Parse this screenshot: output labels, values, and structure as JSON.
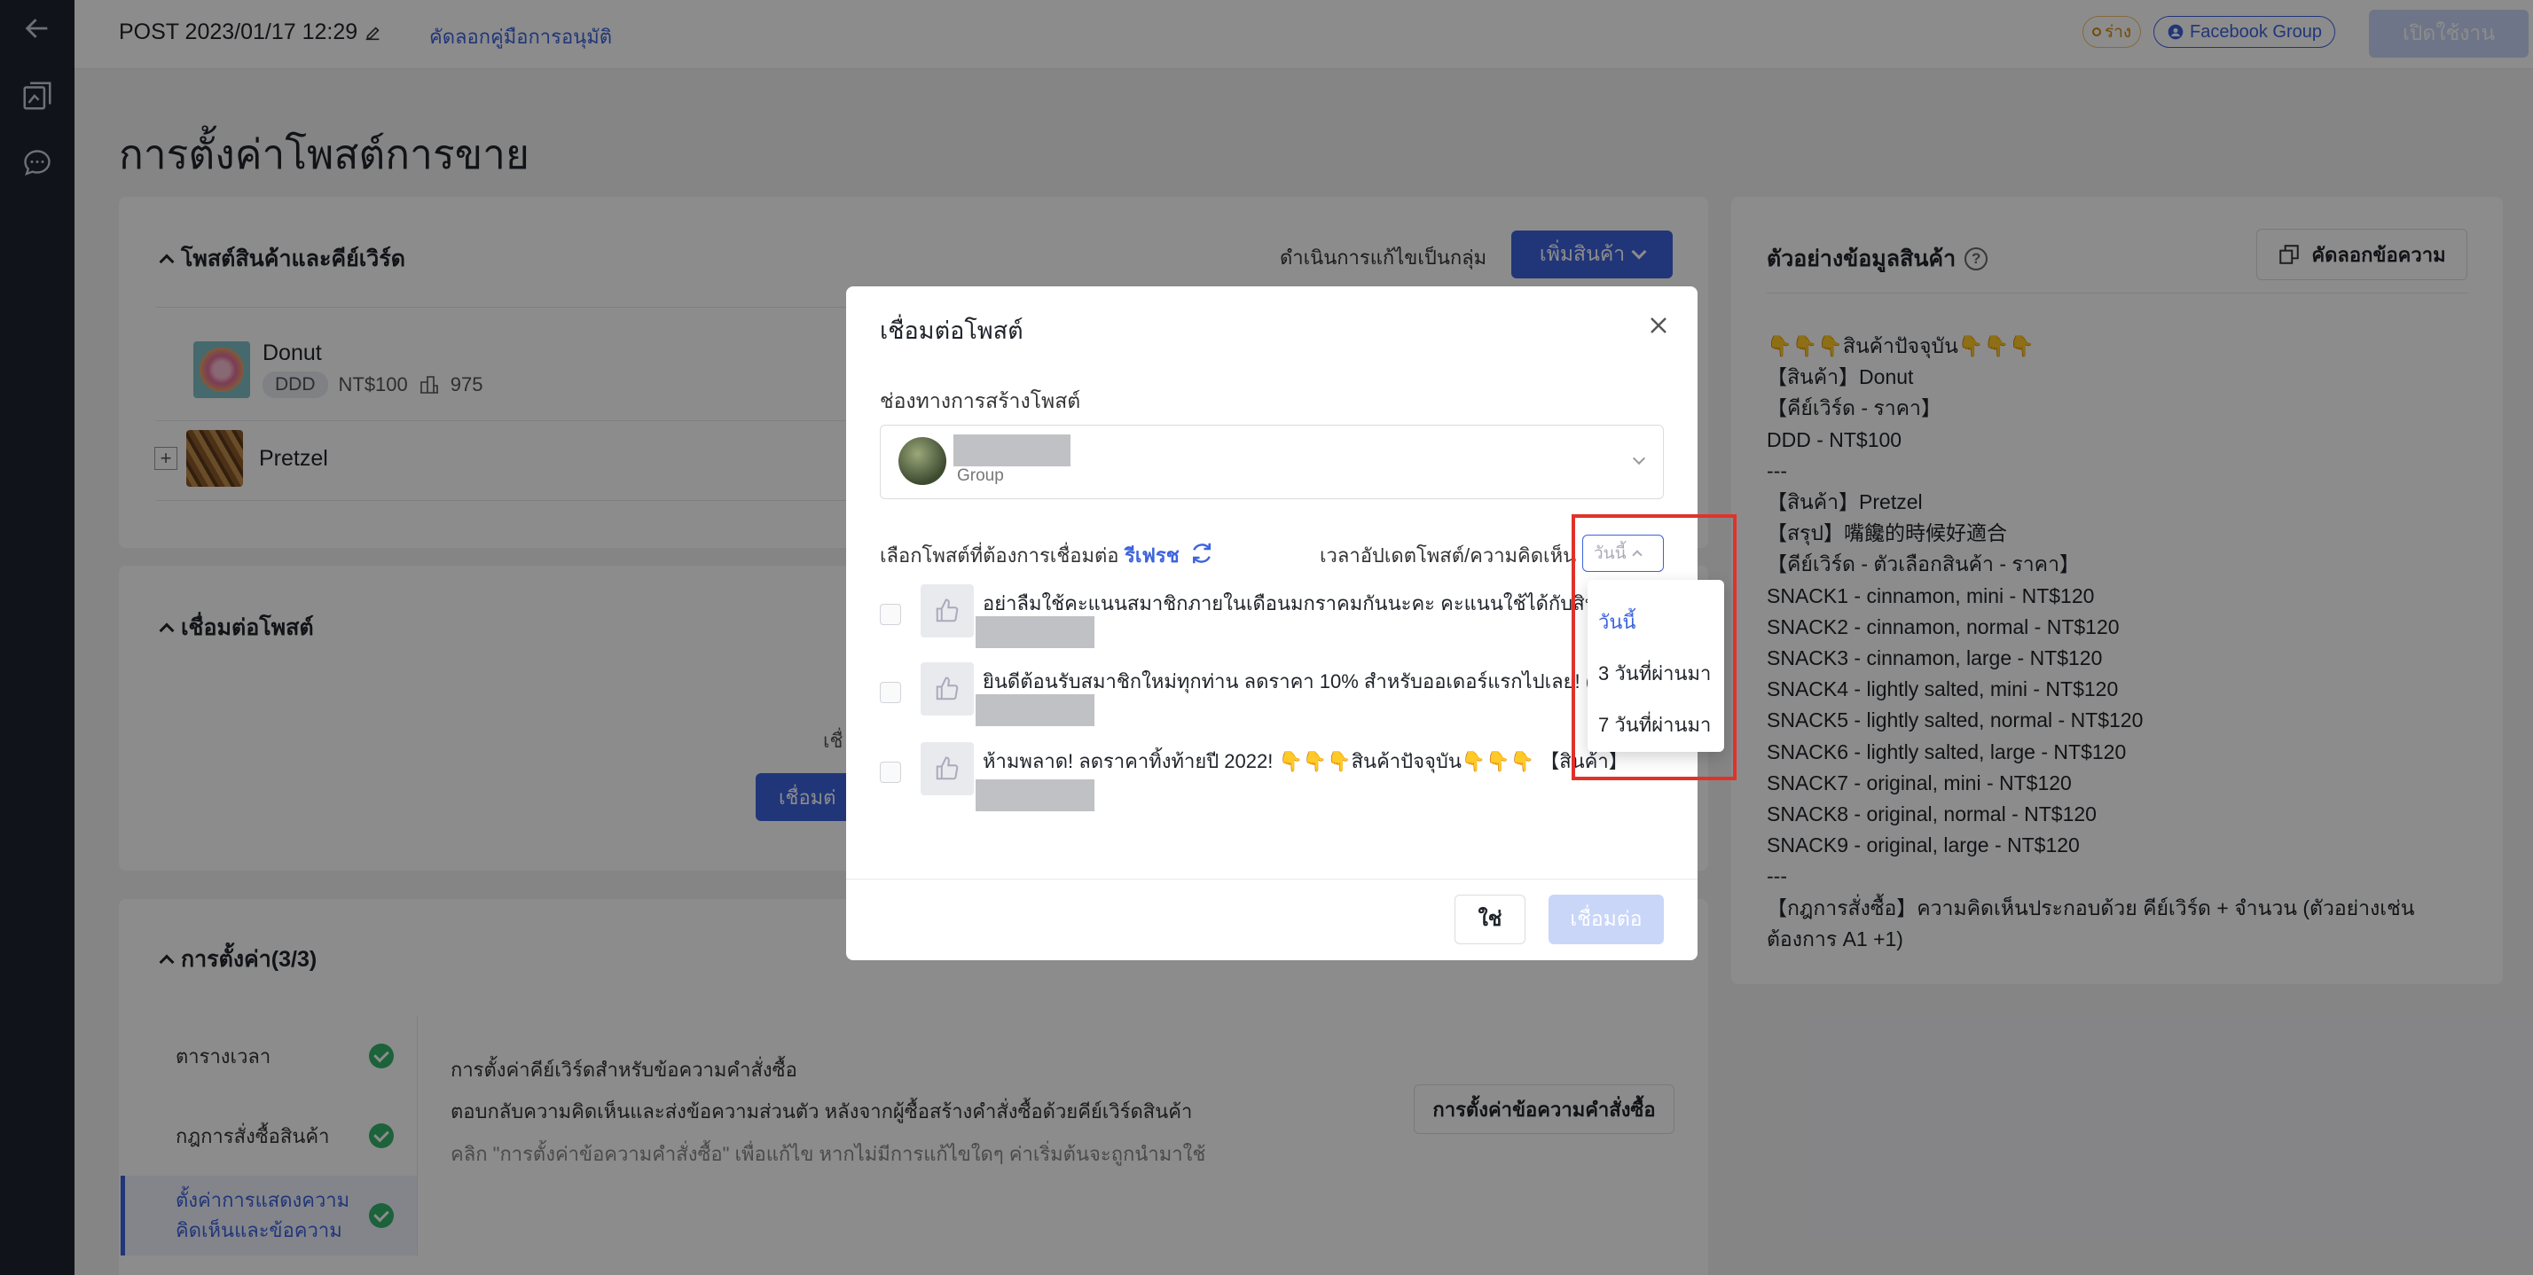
{
  "header": {
    "post_title": "POST 2023/01/17 12:29",
    "copy_guide_link": "คัดลอกคู่มือการอนุมัติ",
    "draft_badge": "ร่าง",
    "fb_group_badge": "Facebook Group",
    "enable_button": "เปิดใช้งาน"
  },
  "page": {
    "title": "การตั้งค่าโพสต์การขาย"
  },
  "products_card": {
    "title": "โพสต์สินค้าและคีย์เวิร์ด",
    "bulk_edit": "ดำเนินการแก้ไขเป็นกลุ่ม",
    "add_product_button": "เพิ่มสินค้า",
    "products": [
      {
        "name": "Donut",
        "keyword": "DDD",
        "price": "NT$100",
        "stock": "975"
      },
      {
        "name": "Pretzel"
      }
    ]
  },
  "connect_card": {
    "title": "เชื่อมต่อโพสต์",
    "hint_fragment": "เชื่",
    "button": "เชื่อมต่"
  },
  "settings_card": {
    "title": "การตั้งค่า(3/3)",
    "steps": [
      {
        "label": "ตารางเวลา"
      },
      {
        "label": "กฎการสั่งซื้อสินค้า"
      },
      {
        "label": "ตั้งค่าการแสดงความคิดเห็นและข้อความ"
      }
    ],
    "heading": "การตั้งค่าคีย์เวิร์ดสำหรับข้อความคำสั่งซื้อ",
    "description": "ตอบกลับความคิดเห็นและส่งข้อความส่วนตัว หลังจากผู้ซื้อสร้างคำสั่งซื้อด้วยคีย์เวิร์ดสินค้า",
    "note": "คลิก \"การตั้งค่าข้อความคำสั่งซื้อ\" เพื่อแก้ไข หากไม่มีการแก้ไขใดๆ ค่าเริ่มต้นจะถูกนำมาใช้",
    "order_message_button": "การตั้งค่าข้อความคำสั่งซื้อ"
  },
  "preview": {
    "title": "ตัวอย่างข้อมูลสินค้า",
    "copy_button": "คัดลอกข้อความ",
    "lines": [
      "👇👇👇สินค้าปัจจุบัน👇👇👇",
      "【สินค้า】Donut",
      "【คีย์เวิร์ด - ราคา】",
      "DDD - NT$100",
      "---",
      "【สินค้า】Pretzel",
      "【สรุป】嘴饞的時候好適合",
      "【คีย์เวิร์ด - ตัวเลือกสินค้า - ราคา】",
      "SNACK1 - cinnamon, mini - NT$120",
      "SNACK2 - cinnamon, normal - NT$120",
      "SNACK3 - cinnamon, large - NT$120",
      "SNACK4 - lightly salted, mini - NT$120",
      "SNACK5 - lightly salted, normal - NT$120",
      "SNACK6 - lightly salted, large - NT$120",
      "SNACK7 - original, mini - NT$120",
      "SNACK8 - original, normal - NT$120",
      "SNACK9 - original, large - NT$120",
      "---",
      "【กฎการสั่งซื้อ】ความคิดเห็นประกอบด้วย คีย์เวิร์ด + จำนวน (ตัวอย่างเช่น ต้องการ A1 +1)"
    ]
  },
  "modal": {
    "title": "เชื่อมต่อโพสต์",
    "channel_label": "ช่องทางการสร้างโพสต์",
    "channel_type": "Group",
    "select_post_label": "เลือกโพสต์ที่ต้องการเชื่อมต่อ",
    "refresh_link": "รีเฟรช",
    "update_time_label": "เวลาอัปเดตโพสต์/ความคิดเห็น",
    "time_select_value": "วันนี้",
    "posts": [
      {
        "text": "อย่าลืมใช้คะแนนสมาชิกภายในเดือนมกราคมกันนะคะ คะแนนใช้ได้กับสินค้าทุก"
      },
      {
        "text": "ยินดีต้อนรับสมาชิกใหม่ทุกท่าน ลดราคา 10% สำหรับออเดอร์แรกไปเลย! ("
      },
      {
        "text": "ห้ามพลาด! ลดราคาทิ้งท้ายปี 2022! 👇👇👇สินค้าปัจจุบัน👇👇👇 【สินค้า】..."
      }
    ],
    "yes_button": "ใช่",
    "connect_button": "เชื่อมต่อ"
  },
  "time_dropdown": {
    "options": [
      "วันนี้",
      "3 วันที่ผ่านมา",
      "7 วันที่ผ่านมา"
    ],
    "selected": "วันนี้"
  },
  "colors": {
    "primary": "#3d63dd",
    "rail": "#1e2430",
    "success": "#33b36b",
    "highlight": "#e0322b"
  }
}
